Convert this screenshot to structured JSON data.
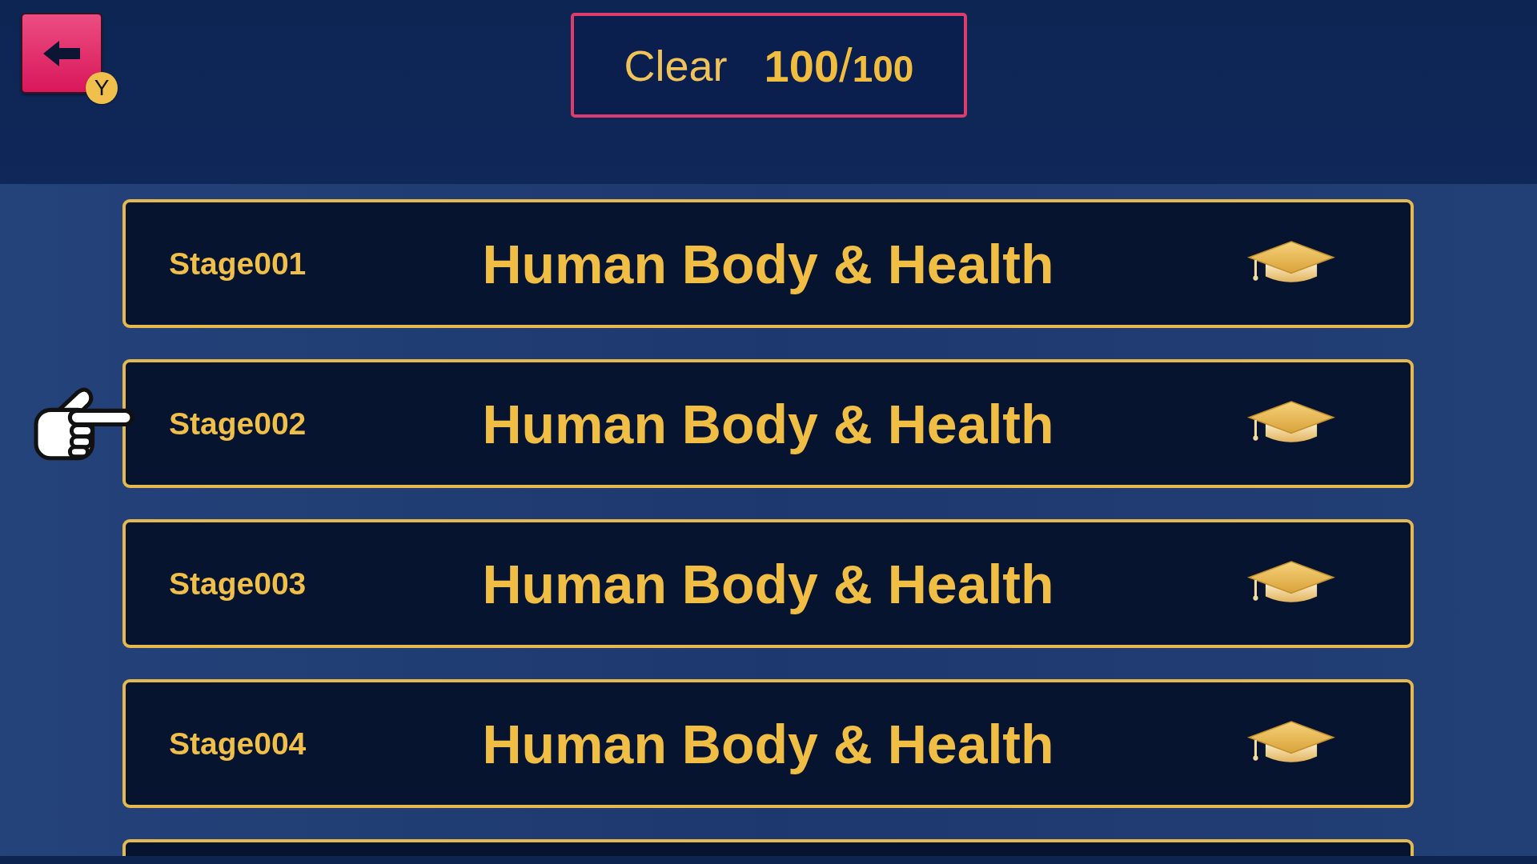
{
  "back_button": {
    "key_hint": "Y"
  },
  "clear_counter": {
    "label": "Clear",
    "cleared": "100",
    "separator": "/",
    "total": "100"
  },
  "stages": [
    {
      "number": "Stage001",
      "title": "Human Body & Health",
      "selected": false
    },
    {
      "number": "Stage002",
      "title": "Human Body & Health",
      "selected": true
    },
    {
      "number": "Stage003",
      "title": "Human Body & Health",
      "selected": false
    },
    {
      "number": "Stage004",
      "title": "Human Body & Health",
      "selected": false
    }
  ]
}
